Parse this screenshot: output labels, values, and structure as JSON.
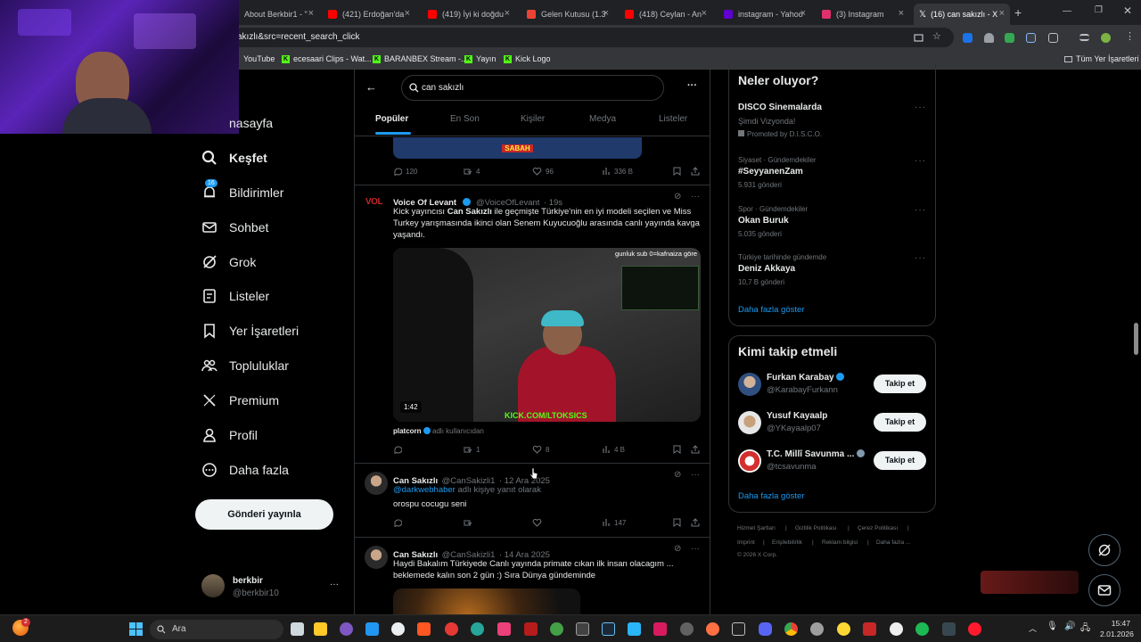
{
  "browser": {
    "tabs": [
      {
        "label": "About Berkbir1 - \"",
        "color": "#9aa0a6"
      },
      {
        "label": "(421) Erdoğan'da",
        "color": "#ff0000"
      },
      {
        "label": "(419) İyi ki doğdu",
        "color": "#ff0000"
      },
      {
        "label": "Gelen Kutusu (1.3",
        "color": "#ea4335"
      },
      {
        "label": "(418) Ceylan - An",
        "color": "#ff0000"
      },
      {
        "label": "instagram - Yahoo",
        "color": "#6001d2"
      },
      {
        "label": "(3) Instagram",
        "color": "#e1306c"
      },
      {
        "label": "(16) can sakızlı - X",
        "color": "#ffffff"
      }
    ],
    "new_tab": "+",
    "url": "akızlı&src=recent_search_click",
    "bookmarks": [
      "YouTube",
      "ecesaari Clips - Wat...",
      "BARANBEX Stream -...",
      "Yayın",
      "Kick Logo"
    ],
    "all_bookmarks": "Tüm Yer İşaretleri"
  },
  "sidebar": {
    "items": [
      {
        "label": "nasayfa",
        "icon": "home-icon"
      },
      {
        "label": "Keşfet",
        "icon": "search-icon"
      },
      {
        "label": "Bildirimler",
        "icon": "bell-icon",
        "badge": "16"
      },
      {
        "label": "Sohbet",
        "icon": "mail-icon"
      },
      {
        "label": "Grok",
        "icon": "grok-icon"
      },
      {
        "label": "Listeler",
        "icon": "list-icon"
      },
      {
        "label": "Yer İşaretleri",
        "icon": "bookmark-icon"
      },
      {
        "label": "Topluluklar",
        "icon": "communities-icon"
      },
      {
        "label": "Premium",
        "icon": "x-logo-icon"
      },
      {
        "label": "Profil",
        "icon": "person-icon"
      },
      {
        "label": "Daha fazla",
        "icon": "more-circle-icon"
      }
    ],
    "post_button": "Gönderi yayınla",
    "account": {
      "name": "berkbir",
      "handle": "@berkbir10",
      "more": "···"
    }
  },
  "search": {
    "query": "can sakızlı",
    "tabs": [
      "Popüler",
      "En Son",
      "Kişiler",
      "Medya",
      "Listeler"
    ]
  },
  "tweets": [
    {
      "image_label": "SABAH",
      "actions": {
        "reply": "120",
        "retweet": "4",
        "like": "96",
        "views": "336 B"
      }
    },
    {
      "name": "Voice Of Levant",
      "handle": "@VoiceOfLevant",
      "time": "· 19s",
      "avatar_text": "VOL",
      "text_pre": "Kick yayıncısı ",
      "text_bold": "Can Sakızlı",
      "text_post": " ile geçmişte Türkiye'nin en iyi modeli seçilen ve Miss Turkey yarışmasında ikinci olan Senem Kuyucuoğlu arasında canlı yayında kavga yaşandı.",
      "video_overlay": "gunluk sub 0=kafnaiza göre",
      "video_duration": "1:42",
      "video_watermark": "KICK.COM/LTOKSICS",
      "attribution_user": "platcorn",
      "attribution_suffix": "adlı kullanıcıdan",
      "actions": {
        "reply": "",
        "retweet": "1",
        "like": "8",
        "views": "4 B"
      }
    },
    {
      "name": "Can Sakızlı",
      "handle": "@CanSakizli1",
      "time": "· 12 Ara 2025",
      "reply_to": "@darkwebhaber",
      "reply_suffix": "adlı kişiye yanıt olarak",
      "text": "orospu cocugu seni",
      "actions": {
        "reply": "",
        "retweet": "",
        "like": "",
        "views": "147"
      }
    },
    {
      "name": "Can Sakızlı",
      "handle": "@CanSakizli1",
      "time": "· 14 Ara 2025",
      "text": "Haydi Bakalım Türkiyede Canlı yayında primate cıkan ilk insan olacagım ... beklemede kalın son 2 gün :) Sıra Dünya gündeminde"
    }
  ],
  "trends": {
    "title": "Neler oluyor?",
    "items": [
      {
        "category": "",
        "title": "DISCO Sinemalarda",
        "sub": "Şimdi Vizyonda!",
        "meta": "Promoted by D.I.S.C.O."
      },
      {
        "category": "Siyaset · Gündemdekiler",
        "title": "#SeyyanenZam",
        "meta": "5.931 gönderi"
      },
      {
        "category": "Spor · Gündemdekiler",
        "title": "Okan Buruk",
        "meta": "5.035 gönderi"
      },
      {
        "category": "Türkiye tarihinde gündemde",
        "title": "Deniz Akkaya",
        "meta": "10,7 B gönderi"
      }
    ],
    "show_more": "Daha fazla göster"
  },
  "who_to_follow": {
    "title": "Kimi takip etmeli",
    "items": [
      {
        "name": "Furkan Karabay",
        "handle": "@KarabayFurkann",
        "button": "Takip et"
      },
      {
        "name": "Yusuf Kayaalp",
        "handle": "@YKayaalp07",
        "button": "Takip et"
      },
      {
        "name": "T.C. Millî Savunma ...",
        "handle": "@tcsavunma",
        "button": "Takip et"
      }
    ],
    "show_more": "Daha fazla göster"
  },
  "footer": {
    "links": [
      "Hizmet Şartları",
      "Gizlilik Politikası",
      "Çerez Politikası",
      "Imprint",
      "Erişilebilirlik",
      "Reklam bilgisi",
      "Daha fazla ..."
    ],
    "copyright": "© 2026 X Corp."
  },
  "taskbar": {
    "search": "Ara",
    "time": "15:47",
    "date": "2.01.2026",
    "weather_badge": "2"
  },
  "colors": {
    "accent": "#1d9bf0",
    "background": "#000000",
    "border": "#2f3336",
    "muted": "#71767b"
  }
}
